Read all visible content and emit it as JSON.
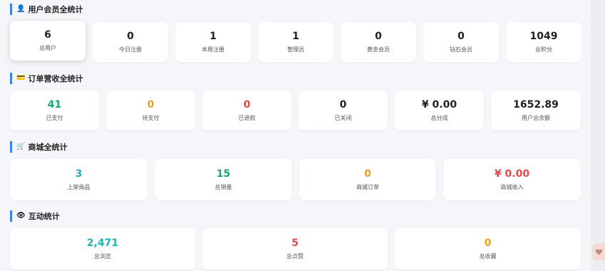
{
  "sections": {
    "user": {
      "title": "用户会员全统计",
      "icon": "user-icon",
      "cards": [
        {
          "value": "6",
          "label": "总用户"
        },
        {
          "value": "0",
          "label": "今日注册"
        },
        {
          "value": "1",
          "label": "本周注册"
        },
        {
          "value": "1",
          "label": "管理员"
        },
        {
          "value": "0",
          "label": "黄金会员"
        },
        {
          "value": "0",
          "label": "钻石会员"
        },
        {
          "value": "1049",
          "label": "总积分"
        }
      ]
    },
    "order": {
      "title": "订单营收全统计",
      "icon": "card-icon",
      "cards": [
        {
          "value": "41",
          "label": "已支付"
        },
        {
          "value": "0",
          "label": "待支付"
        },
        {
          "value": "0",
          "label": "已退款"
        },
        {
          "value": "0",
          "label": "已关闭"
        },
        {
          "value": "¥ 0.00",
          "label": "总分成"
        },
        {
          "value": "1652.89",
          "label": "用户总余额"
        }
      ]
    },
    "shop": {
      "title": "商城全统计",
      "icon": "cart-icon",
      "cards": [
        {
          "value": "3",
          "label": "上架商品"
        },
        {
          "value": "15",
          "label": "总销量"
        },
        {
          "value": "0",
          "label": "商城订单"
        },
        {
          "value": "¥ 0.00",
          "label": "商城收入"
        }
      ]
    },
    "interact": {
      "title": "互动统计",
      "icon": "eye-icon",
      "cards": [
        {
          "value": "2,471",
          "label": "总浏览"
        },
        {
          "value": "5",
          "label": "总点赞"
        },
        {
          "value": "0",
          "label": "总收藏"
        }
      ]
    }
  },
  "colors": {
    "accent": "#3b82f6",
    "green": "#1aa873",
    "orange": "#f0a11b",
    "red": "#e04b4b",
    "teal": "#1fb3bd"
  },
  "side": {
    "icon": "heart-icon"
  }
}
